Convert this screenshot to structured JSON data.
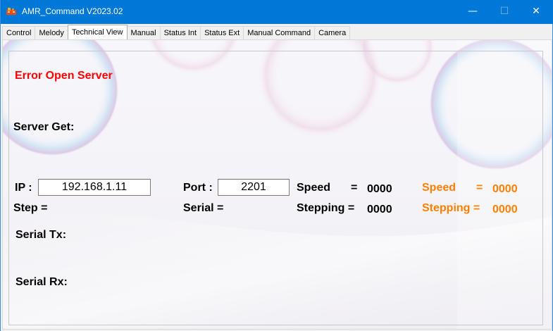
{
  "window": {
    "title": "AMR_Command V2023.02",
    "minimize_glyph": "—",
    "maximize_glyph": "☐",
    "close_glyph": "✕"
  },
  "tabs": [
    {
      "label": "Control"
    },
    {
      "label": "Melody"
    },
    {
      "label": "Technical View",
      "active": true
    },
    {
      "label": "Manual"
    },
    {
      "label": "Status Int"
    },
    {
      "label": "Status Ext"
    },
    {
      "label": "Manual Command"
    },
    {
      "label": "Camera"
    }
  ],
  "technical_view": {
    "error_message": "Error Open Server",
    "server_get_label": "Server Get:",
    "ip_label": "IP :",
    "ip_value": "192.168.1.11",
    "port_label": "Port :",
    "port_value": "2201",
    "step_label": "Step =",
    "serial_label": "Serial =",
    "speed_label": "Speed",
    "speed_eq": "=",
    "speed_value": "0000",
    "stepping_label": "Stepping =",
    "stepping_value": "0000",
    "speed2_label": "Speed",
    "speed2_eq": "=",
    "speed2_value": "0000",
    "stepping2_label": "Stepping =",
    "stepping2_value": "0000",
    "serial_tx_label": "Serial Tx:",
    "serial_rx_label": "Serial Rx:"
  },
  "colors": {
    "titlebar": "#0078d7",
    "error": "#ff0000",
    "secondary_readout": "#ff7f00"
  }
}
